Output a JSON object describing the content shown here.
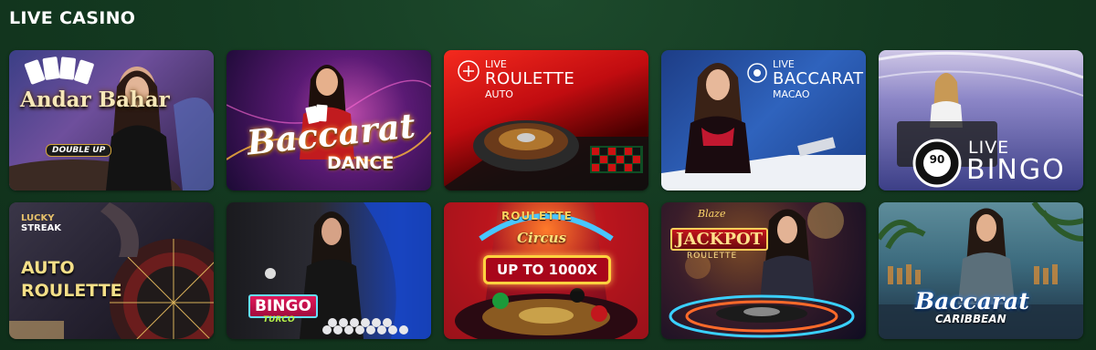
{
  "section": {
    "title": "LIVE CASINO"
  },
  "games": [
    {
      "id": "andar-bahar",
      "title": "Andar Bahar",
      "subtitle": "DOUBLE UP"
    },
    {
      "id": "baccarat-dance",
      "title": "Baccarat",
      "subtitle": "DANCE"
    },
    {
      "id": "live-roulette-auto",
      "tag": "LIVE",
      "title": "ROULETTE",
      "subtitle": "AUTO"
    },
    {
      "id": "live-baccarat-macao",
      "tag": "LIVE",
      "title": "BACCARAT",
      "subtitle": "MACAO"
    },
    {
      "id": "live-bingo",
      "tag": "LIVE",
      "title": "BINGO",
      "badge": "90"
    },
    {
      "id": "auto-roulette",
      "brand_top": "LUCKY",
      "brand_bottom": "STREAK",
      "title_line1": "AUTO",
      "title_line2": "ROULETTE"
    },
    {
      "id": "bingo-turco",
      "title": "BINGO",
      "subtitle": "TURCO"
    },
    {
      "id": "roulette-circus",
      "title": "ROULETTE",
      "subtitle": "Circus",
      "promo": "UP TO 1000X"
    },
    {
      "id": "blaze-jackpot-roulette",
      "brand": "Blaze",
      "title": "JACKPOT",
      "subtitle": "ROULETTE"
    },
    {
      "id": "baccarat-caribbean",
      "title": "Baccarat",
      "subtitle": "CARIBBEAN"
    }
  ]
}
